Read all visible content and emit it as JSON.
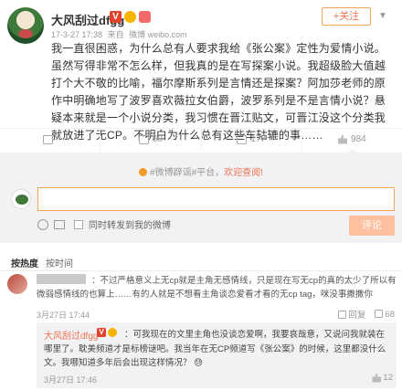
{
  "post": {
    "username": "大风刮过dfgg",
    "badge_v": "V",
    "meta": {
      "time": "17-3-27 17:38",
      "source_prefix": "来自",
      "source": "微博 weibo.com"
    },
    "follow_label": "+关注",
    "content": "我一直很困惑，为什么总有人要求我给《张公案》定性为爱情小说。虽然写得非常不怎么样，但我真的是在写探案小说。我超级脸大值越打个大不敬的比喻，福尔摩斯系列是言情还是探案？阿加莎老师的原作中明确地写了波罗喜欢薇拉女伯爵，波罗系列是不是言情小说？悬疑本来就是一个小说分类，我习惯在晋江贴文，可晋江没这个分类我就放进了无CP。不明白为什么总有这些车轱辘的事……"
  },
  "actions": [
    {
      "name": "favorite",
      "label": ""
    },
    {
      "name": "repost",
      "label": "60"
    },
    {
      "name": "comment",
      "label": "177"
    },
    {
      "name": "like",
      "label": "984"
    }
  ],
  "comment_box": {
    "notice_text": "#微博辟谣#平台，",
    "notice_link": "欢迎查阅!",
    "input_value": "",
    "repost_checkbox_label": "同时转发到我的微博",
    "submit_label": "评论"
  },
  "sort": {
    "hot": "按热度",
    "time": "按时间"
  },
  "comment": {
    "text": "：不过严格意义上无cp就是主角无感情线，只是现在写无cp的真的太少了所以有微弱感情线的也算上……有的人就是不想看主角谈恋爱看才看的无cp tag，咪没事撒撒你",
    "time": "3月27日 17:44",
    "reply_label": "回复",
    "like_count": "68"
  },
  "reply": {
    "username": "大风刮过dfgg",
    "text": "：可我现在的文里主角也没谈恋爱啊，我要哀哉意，又说问我就装在哪里了。耽美频道才是标榜谜吧。我当年在无CP频道写《张公案》的时候，这里都没什么文。我哪知道多年后会出现这样情况？ 😓",
    "time": "3月27日 17:46",
    "like_count": "12"
  },
  "colors": {
    "accent": "#eb7350",
    "follow_border": "#f2a65a",
    "submit_bg": "#ffc09f",
    "panel_bg": "#f2f2f5"
  }
}
